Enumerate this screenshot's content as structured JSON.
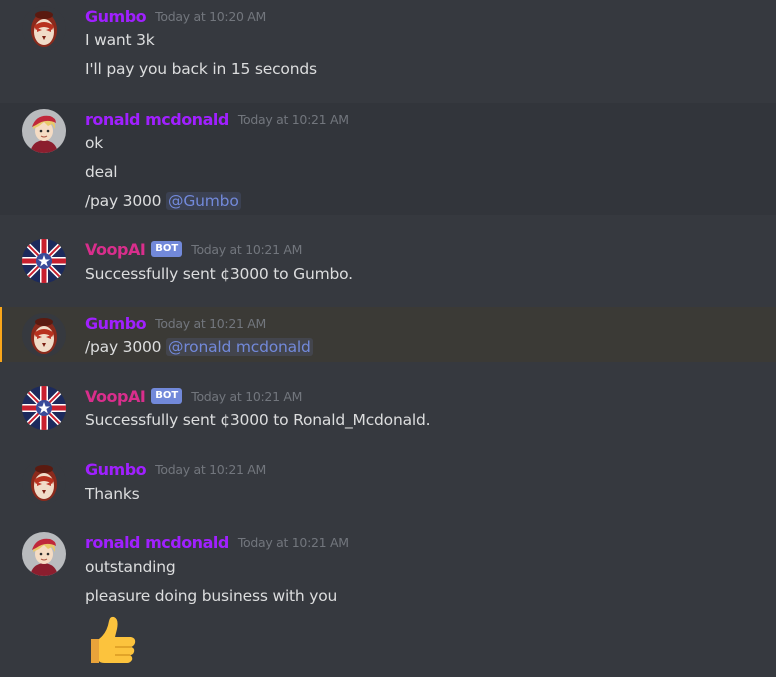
{
  "colors": {
    "background": "#36393f",
    "gumbo_name": "#a020ff",
    "voop_name": "#d92e8c",
    "mention_text": "#7289da",
    "bot_tag": "#7289da",
    "timestamp": "#72767d",
    "mention_highlight_bar": "#faa61a"
  },
  "messages": [
    {
      "author": "Gumbo",
      "timestamp": "Today at 10:20 AM",
      "avatar": "red-mask-avatar",
      "lines": [
        "I want 3k",
        "I'll pay you back in 15 seconds"
      ]
    },
    {
      "author": "ronald mcdonald",
      "timestamp": "Today at 10:21 AM",
      "avatar": "anime-character-avatar",
      "lines": [
        "ok",
        "deal"
      ],
      "command": {
        "text": "/pay 3000",
        "mention": "@Gumbo"
      }
    },
    {
      "author": "VoopAI",
      "bot_tag": "BOT",
      "timestamp": "Today at 10:21 AM",
      "avatar": "flag-globe-avatar",
      "lines": [
        "Successfully sent ¢3000 to Gumbo."
      ]
    },
    {
      "author": "Gumbo",
      "timestamp": "Today at 10:21 AM",
      "avatar": "red-mask-avatar",
      "command": {
        "text": "/pay 3000",
        "mention": "@ronald mcdonald"
      }
    },
    {
      "author": "VoopAI",
      "bot_tag": "BOT",
      "timestamp": "Today at 10:21 AM",
      "avatar": "flag-globe-avatar",
      "lines": [
        "Successfully sent ¢3000 to Ronald_Mcdonald."
      ]
    },
    {
      "author": "Gumbo",
      "timestamp": "Today at 10:21 AM",
      "avatar": "red-mask-avatar",
      "lines": [
        "Thanks"
      ]
    },
    {
      "author": "ronald mcdonald",
      "timestamp": "Today at 10:21 AM",
      "avatar": "anime-character-avatar",
      "lines": [
        "outstanding",
        "pleasure doing business with you"
      ],
      "emoji": "thumbs-up-icon"
    }
  ]
}
